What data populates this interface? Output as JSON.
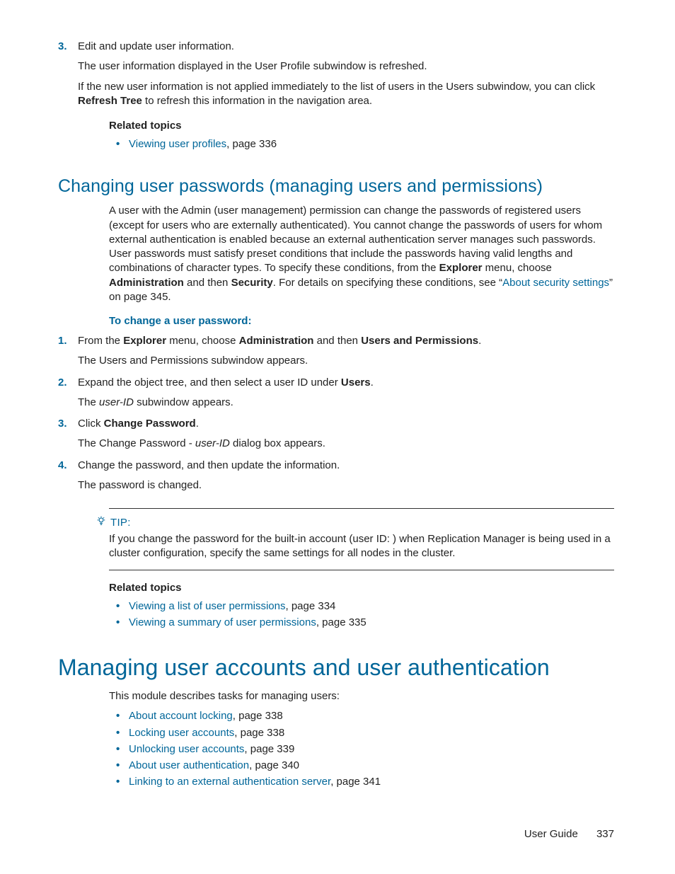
{
  "step3": {
    "num": "3.",
    "line1": "Edit and update user information.",
    "line2": "The user information displayed in the User Profile subwindow is refreshed.",
    "line3a": "If the new user information is not applied immediately to the list of users in the Users subwindow, you can click ",
    "line3b": "Refresh Tree",
    "line3c": " to refresh this information in the navigation area."
  },
  "related1": {
    "heading": "Related topics",
    "item1_link": "Viewing user profiles",
    "item1_suffix": ", page 336"
  },
  "sectionA": {
    "title": "Changing user passwords (managing users and permissions)",
    "para_a": "A user with the Admin (user management) permission can change the passwords of registered users (except for users who are externally authenticated). You cannot change the passwords of users for whom external authentication is enabled because an external authentication server manages such passwords. User passwords must satisfy preset conditions that include the passwords having valid lengths and combinations of character types. To specify these conditions, from the ",
    "para_b": "Explorer",
    "para_c": " menu, choose ",
    "para_d": "Administration",
    "para_e": " and then ",
    "para_f": "Security",
    "para_g": ". For details on specifying these conditions, see “",
    "para_link": "About security settings",
    "para_h": "” on page 345.",
    "proc_heading": "To change a user password:",
    "steps": [
      {
        "num": "1.",
        "parts": [
          {
            "t": "From the "
          },
          {
            "t": "Explorer",
            "b": true
          },
          {
            "t": " menu, choose "
          },
          {
            "t": "Administration",
            "b": true
          },
          {
            "t": " and then "
          },
          {
            "t": "Users and Permissions",
            "b": true
          },
          {
            "t": "."
          }
        ],
        "after": "The Users and Permissions subwindow appears."
      },
      {
        "num": "2.",
        "parts": [
          {
            "t": "Expand the object tree, and then select a user ID under "
          },
          {
            "t": "Users",
            "b": true
          },
          {
            "t": "."
          }
        ],
        "after_parts": [
          {
            "t": "The "
          },
          {
            "t": "user-ID",
            "i": true
          },
          {
            "t": " subwindow appears."
          }
        ]
      },
      {
        "num": "3.",
        "parts": [
          {
            "t": "Click "
          },
          {
            "t": "Change Password",
            "b": true
          },
          {
            "t": "."
          }
        ],
        "after_parts": [
          {
            "t": "The Change Password - "
          },
          {
            "t": "user-ID",
            "i": true
          },
          {
            "t": " dialog box appears."
          }
        ]
      },
      {
        "num": "4.",
        "parts": [
          {
            "t": "Change the password, and then update the information."
          }
        ],
        "after": "The password is changed."
      }
    ]
  },
  "tip": {
    "label": "TIP:",
    "text": "If you change the password for the built-in account (user ID:             ) when Replication Manager is being used in a cluster configuration, specify the same settings for all nodes in the cluster."
  },
  "related2": {
    "heading": "Related topics",
    "items": [
      {
        "link": "Viewing a list of user permissions",
        "suffix": ", page 334"
      },
      {
        "link": "Viewing a summary of user permissions",
        "suffix": ", page 335"
      }
    ]
  },
  "chapter": {
    "title": "Managing user accounts and user authentication",
    "intro": "This module describes tasks for managing users:",
    "items": [
      {
        "link": "About account locking",
        "suffix": ", page 338"
      },
      {
        "link": "Locking user accounts",
        "suffix": ", page 338"
      },
      {
        "link": "Unlocking user accounts",
        "suffix": ", page 339"
      },
      {
        "link": "About user authentication",
        "suffix": ", page 340"
      },
      {
        "link": "Linking to an external authentication server",
        "suffix": ", page 341"
      }
    ]
  },
  "footer": {
    "label": "User Guide",
    "page": "337"
  }
}
